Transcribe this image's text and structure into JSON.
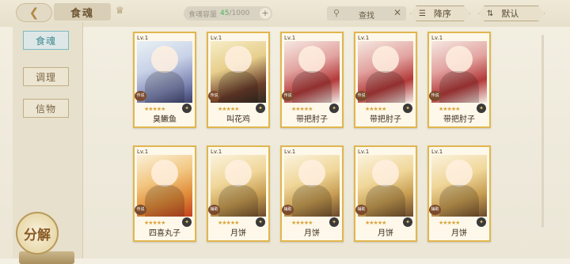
{
  "header": {
    "back_icon": "back-arrow-icon",
    "title": "食魂",
    "capacity_label": "食魂容量",
    "capacity_current": "45",
    "capacity_max": "/1000",
    "search_placeholder": "查找",
    "sort_label": "降序",
    "order_label": "默认"
  },
  "sidebar": {
    "items": [
      {
        "label": "食魂"
      },
      {
        "label": "调理"
      },
      {
        "label": "信物"
      }
    ],
    "decompose_label": "分解"
  },
  "cards": [
    {
      "lv": "Lv.1",
      "name": "臭鳜鱼",
      "badge": "传说",
      "stars": "★★★★★"
    },
    {
      "lv": "Lv.1",
      "name": "叫花鸡",
      "badge": "传说",
      "stars": "★★★★★"
    },
    {
      "lv": "Lv.1",
      "name": "带把肘子",
      "badge": "传说",
      "stars": "★★★★★"
    },
    {
      "lv": "Lv.1",
      "name": "带把肘子",
      "badge": "传说",
      "stars": "★★★★★"
    },
    {
      "lv": "Lv.1",
      "name": "带把肘子",
      "badge": "传说",
      "stars": "★★★★★"
    },
    {
      "lv": "Lv.1",
      "name": "四喜丸子",
      "badge": "传说",
      "stars": "★★★★★"
    },
    {
      "lv": "Lv.1",
      "name": "月饼",
      "badge": "辅助",
      "stars": "★★★★★"
    },
    {
      "lv": "Lv.1",
      "name": "月饼",
      "badge": "辅助",
      "stars": "★★★★★"
    },
    {
      "lv": "Lv.1",
      "name": "月饼",
      "badge": "辅助",
      "stars": "★★★★★"
    },
    {
      "lv": "Lv.1",
      "name": "月饼",
      "badge": "辅助",
      "stars": "★★★★★"
    }
  ],
  "colors": {
    "card_border": "#e1b64e",
    "active_nav": "#7bbac3",
    "capacity_current": "#4fb25a"
  }
}
